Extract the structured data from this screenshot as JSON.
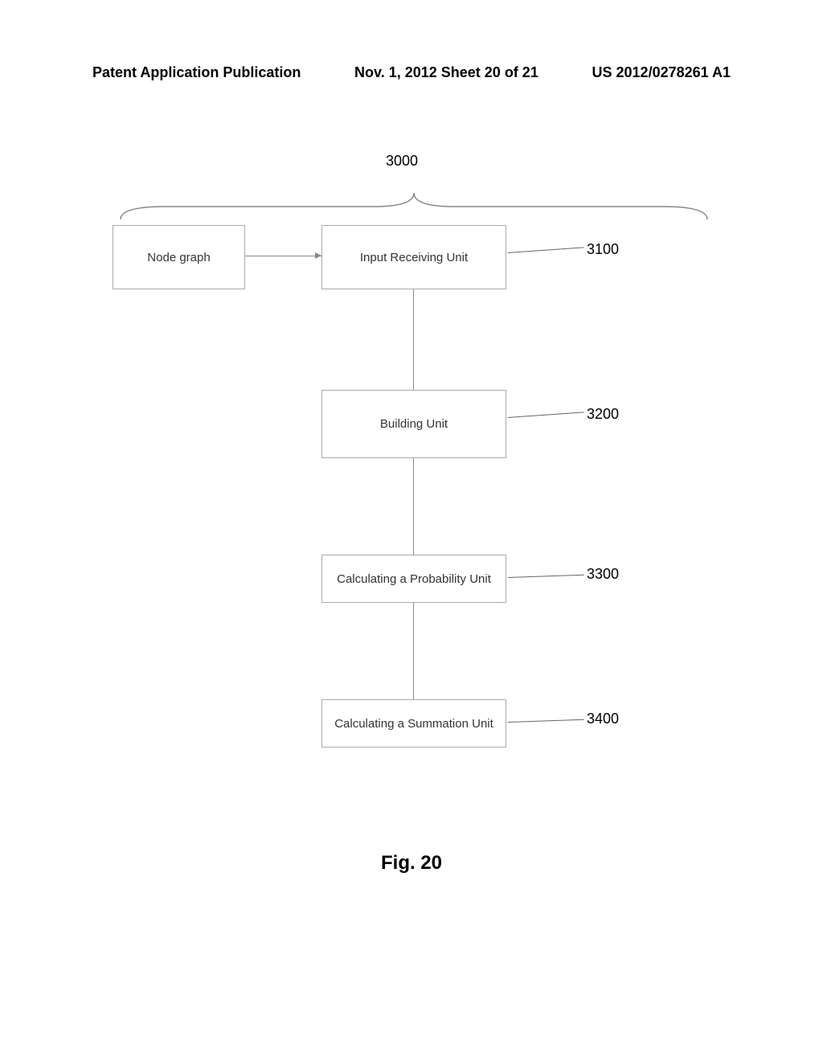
{
  "header": {
    "left": "Patent Application Publication",
    "center": "Nov. 1, 2012   Sheet 20 of 21",
    "right": "US 2012/0278261 A1"
  },
  "diagram": {
    "system_ref": "3000",
    "boxes": {
      "node_graph": {
        "label": "Node graph"
      },
      "input_unit": {
        "label": "Input Receiving Unit",
        "ref": "3100"
      },
      "building_unit": {
        "label": "Building  Unit",
        "ref": "3200"
      },
      "prob_unit": {
        "label": "Calculating a Probability Unit",
        "ref": "3300"
      },
      "sum_unit": {
        "label": "Calculating a Summation Unit",
        "ref": "3400"
      }
    }
  },
  "figure_caption": "Fig. 20"
}
